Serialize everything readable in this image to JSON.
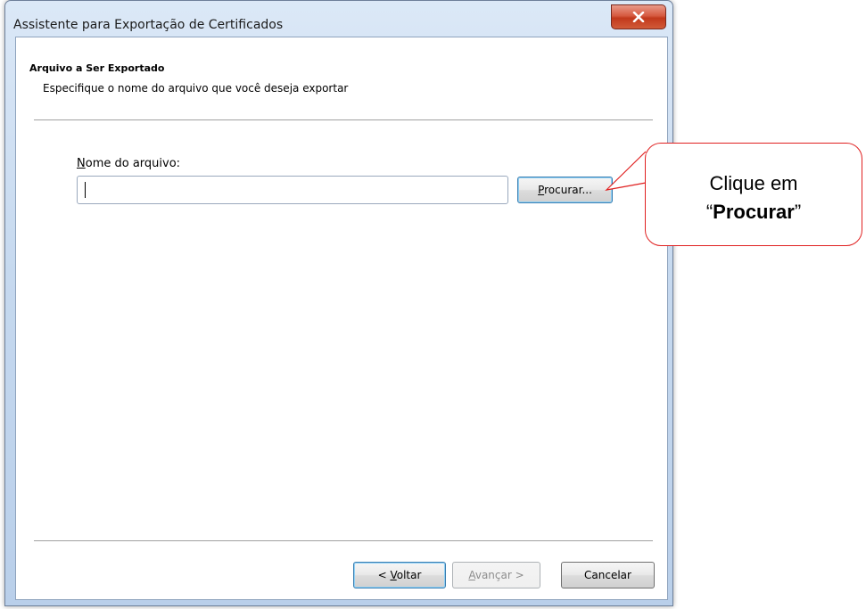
{
  "window": {
    "title": "Assistente para Exportação de Certificados",
    "close_symbol": "x"
  },
  "header": {
    "title": "Arquivo a Ser Exportado",
    "subtitle": "Especifique o nome do arquivo que você deseja exportar"
  },
  "form": {
    "label_accel": "N",
    "label_rest": "ome do arquivo:",
    "file_value": "",
    "browse_accel": "P",
    "browse_rest": "rocurar..."
  },
  "footer": {
    "back_prefix": "< ",
    "back_accel": "V",
    "back_rest": "oltar",
    "next_accel": "A",
    "next_rest": "vançar >",
    "cancel_label": "Cancelar"
  },
  "callout": {
    "line1": "Clique em",
    "open_quote": "“",
    "bold": "Procurar",
    "close_quote": "”"
  },
  "colors": {
    "callout_border": "#e02020",
    "close_button": "#c2391c"
  },
  "icons": {
    "close": "close-icon"
  }
}
